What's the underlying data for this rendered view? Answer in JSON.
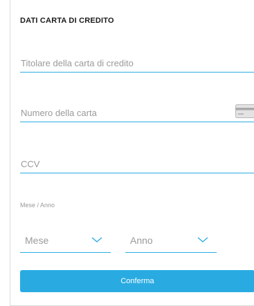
{
  "form": {
    "title": "DATI CARTA DI CREDITO",
    "holder_placeholder": "Titolare della carta di credito",
    "number_placeholder": "Numero della carta",
    "ccv_placeholder": "CCV",
    "expiry_label": "Mese / Anno",
    "month_select": {
      "selected": "Mese"
    },
    "year_select": {
      "selected": "Anno"
    },
    "confirm_label": "Conferma"
  },
  "icons": {
    "card": "credit-card-icon",
    "chevron": "chevron-down-icon"
  },
  "colors": {
    "accent": "#29abe2",
    "placeholder": "#9a9a9a",
    "title": "#1a1a1a",
    "button_text": "#ffffff"
  }
}
